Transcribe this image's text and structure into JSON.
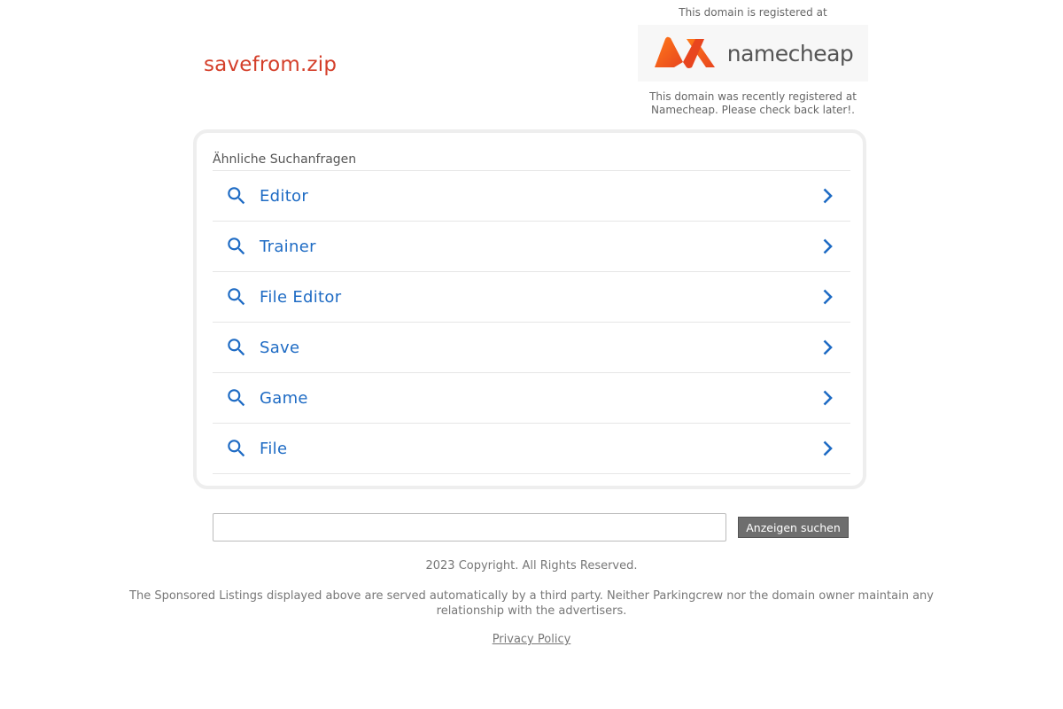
{
  "domain": {
    "name": "savefrom.zip",
    "color": "#d43f2a"
  },
  "registrar": {
    "top_note": "This domain is registered at",
    "logo_text": "namecheap",
    "logo_color": "#ff5d1f",
    "bottom_note_line1": "This domain was recently registered at",
    "bottom_note_line2": "Namecheap. Please check back later!."
  },
  "related": {
    "heading": "Ähnliche Suchanfragen",
    "link_color": "#1e6bc4",
    "items": [
      {
        "label": "Editor"
      },
      {
        "label": "Trainer"
      },
      {
        "label": "File Editor"
      },
      {
        "label": "Save"
      },
      {
        "label": "Game"
      },
      {
        "label": "File"
      }
    ]
  },
  "search": {
    "value": "",
    "button_label": "Anzeigen suchen"
  },
  "footer": {
    "copyright": "2023 Copyright. All Rights Reserved.",
    "disclaimer": "The Sponsored Listings displayed above are served automatically by a third party. Neither Parkingcrew nor the domain owner maintain any relationship with the advertisers.",
    "privacy_label": "Privacy Policy"
  }
}
